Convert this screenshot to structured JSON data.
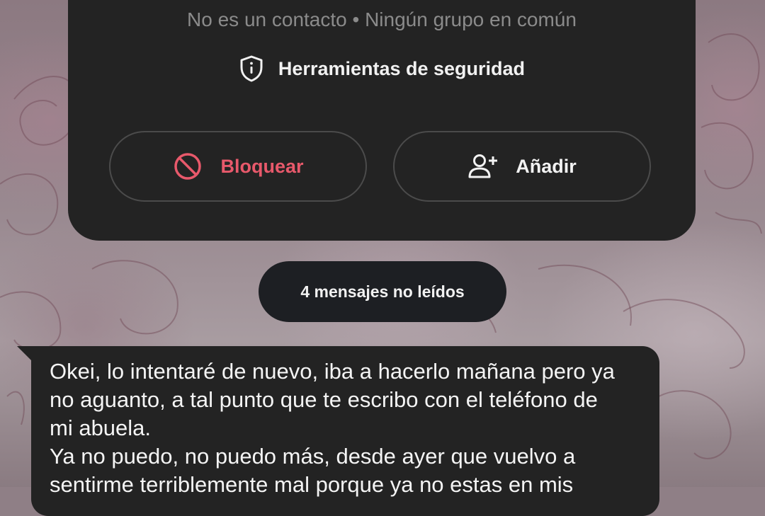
{
  "contact_card": {
    "subtitle": "No es un contacto • Ningún grupo en común",
    "security_tools_label": "Herramientas de seguridad",
    "block_label": "Bloquear",
    "add_label": "Añadir",
    "block_color": "#e8596b"
  },
  "unread_banner": "4 mensajes no leídos",
  "message": {
    "text": "Okei, lo intentaré de nuevo, iba a hacerlo mañana pero ya\nno aguanto, a tal punto que te escribo con el teléfono de\nmi abuela.\nYa no puedo, no puedo más, desde ayer que vuelvo a\nsentirme terriblemente mal porque ya no estas en mis"
  },
  "icons": {
    "security": "shield-info-icon",
    "block": "block-icon",
    "add": "add-person-icon"
  }
}
